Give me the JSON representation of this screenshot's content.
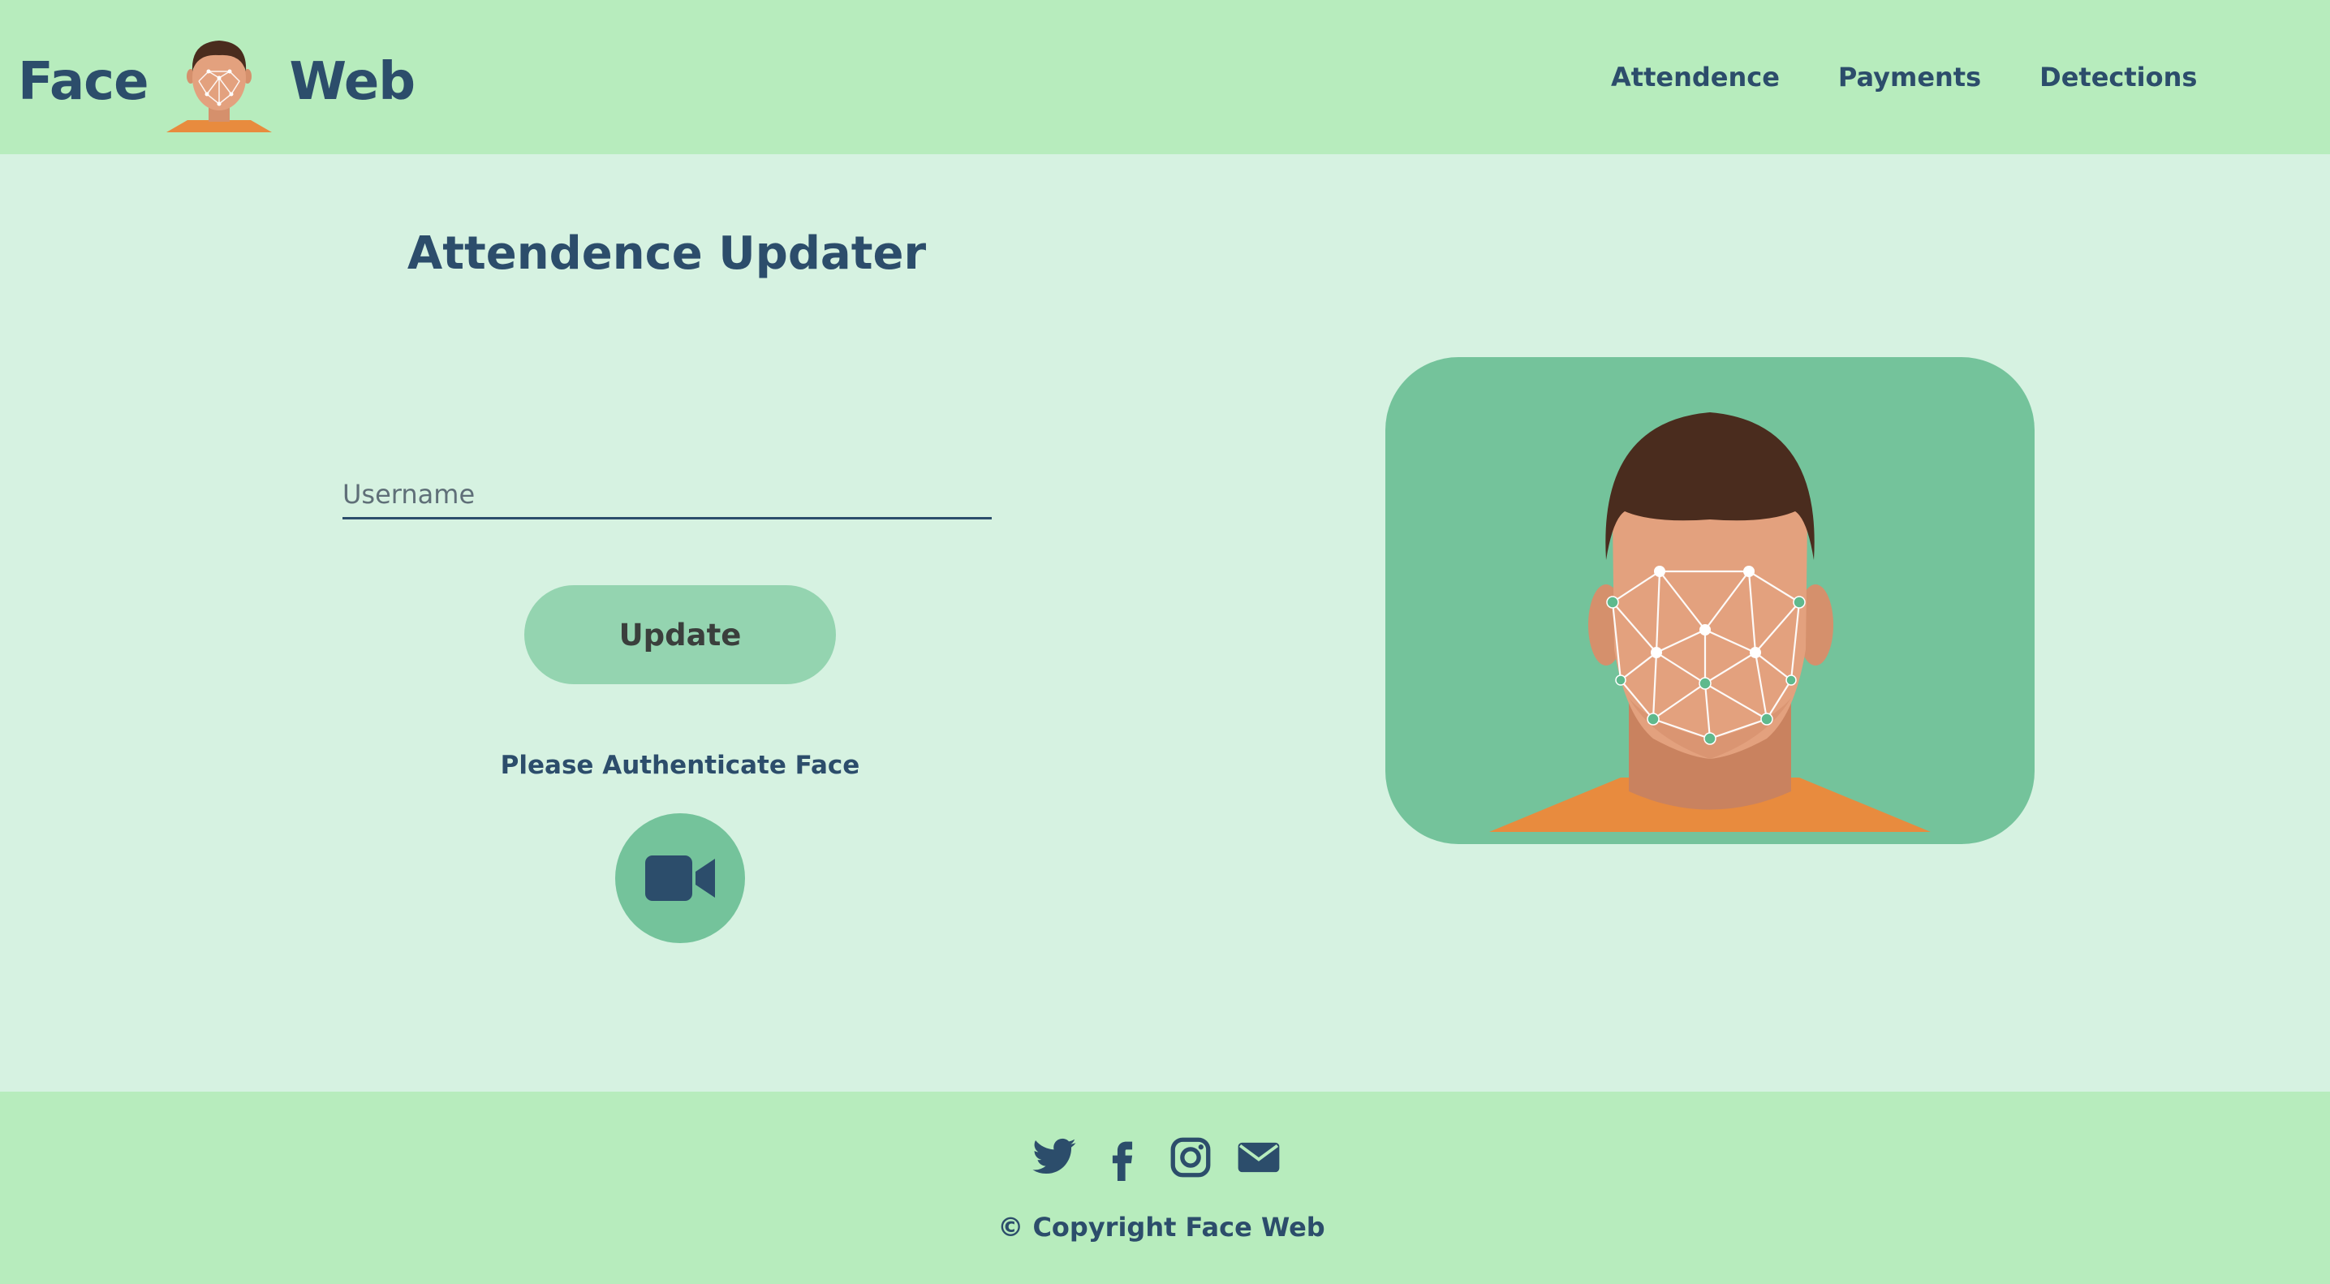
{
  "header": {
    "brand_left": "Face",
    "brand_right": "Web",
    "logo_icon": "face-scan-avatar-icon",
    "nav": [
      {
        "label": "Attendence"
      },
      {
        "label": "Payments"
      },
      {
        "label": "Detections"
      }
    ]
  },
  "main": {
    "title": "Attendence Updater",
    "username_placeholder": "Username",
    "username_value": "",
    "update_label": "Update",
    "auth_prompt": "Please Authenticate Face",
    "camera_icon": "video-camera-icon",
    "hero_image": "face-recognition-mesh-illustration"
  },
  "footer": {
    "social_icons": [
      "twitter-icon",
      "facebook-icon",
      "instagram-icon",
      "envelope-icon"
    ],
    "copyright": "© Copyright Face Web"
  },
  "colors": {
    "navbar_bg": "#b7ecbd",
    "page_bg": "#d6f2e1",
    "accent_green": "#74c39b",
    "button_green": "#94d4b0",
    "text_navy": "#2c4d6b",
    "hair_brown": "#4a2c1e",
    "skin": "#e3a17e",
    "shirt_orange": "#e88b3e"
  }
}
